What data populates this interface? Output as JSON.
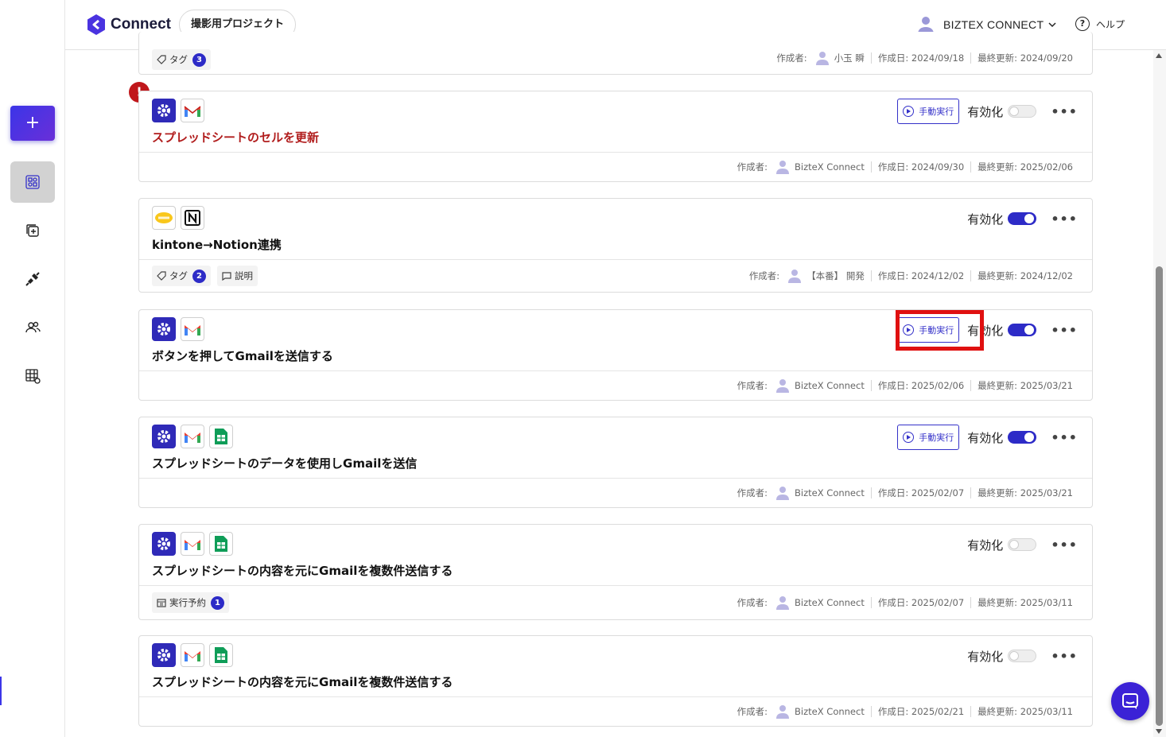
{
  "header": {
    "brand": "Connect",
    "project": "撮影用プロジェクト",
    "user": "BIZTEX CONNECT",
    "help": "ヘルプ"
  },
  "sidebar": {
    "add_label": "+",
    "items": [
      "workflows-icon",
      "templates-icon",
      "connections-icon",
      "members-icon",
      "datastore-icon"
    ]
  },
  "labels": {
    "manual_run": "手動実行",
    "enable": "有効化",
    "more": "•••",
    "creator": "作成者:",
    "created": "作成日:",
    "updated": "最終更新:",
    "tag": "タグ",
    "description": "説明",
    "scheduled": "実行予約"
  },
  "partial_card": {
    "tag_count": "3",
    "creator": "小玉 瞬",
    "created": "2024/09/18",
    "updated": "2024/09/20"
  },
  "cards": [
    {
      "title": "スプレッドシートのセルを更新",
      "creator": "BizteX Connect",
      "created": "2024/09/30",
      "updated": "2025/02/06",
      "enabled": false,
      "error": true
    },
    {
      "title": "kintone→Notion連携",
      "creator": "【本番】 開発",
      "created": "2024/12/02",
      "updated": "2024/12/02",
      "enabled": true,
      "tag_count": "2"
    },
    {
      "title": "ボタンを押してGmailを送信する",
      "creator": "BizteX Connect",
      "created": "2025/02/06",
      "updated": "2025/03/21",
      "enabled": true
    },
    {
      "title": "スプレッドシートのデータを使用しGmailを送信",
      "creator": "BizteX Connect",
      "created": "2025/02/07",
      "updated": "2025/03/21",
      "enabled": true
    },
    {
      "title": "スプレッドシートの内容を元にGmailを複数件送信する",
      "creator": "BizteX Connect",
      "created": "2025/02/07",
      "updated": "2025/03/11",
      "enabled": false,
      "scheduled_count": "1"
    },
    {
      "title": "スプレッドシートの内容を元にGmailを複数件送信する",
      "creator": "BizteX Connect",
      "created": "2025/02/21",
      "updated": "2025/03/11",
      "enabled": false
    }
  ],
  "colors": {
    "accent": "#2d2bc7",
    "error": "#c0171b",
    "highlight": "#e01010"
  }
}
